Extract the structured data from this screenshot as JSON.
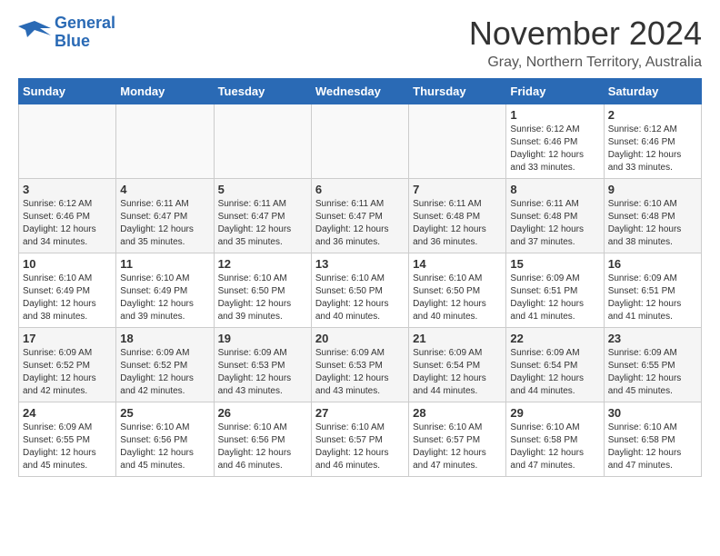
{
  "header": {
    "logo_line1": "General",
    "logo_line2": "Blue",
    "month_title": "November 2024",
    "location": "Gray, Northern Territory, Australia"
  },
  "weekdays": [
    "Sunday",
    "Monday",
    "Tuesday",
    "Wednesday",
    "Thursday",
    "Friday",
    "Saturday"
  ],
  "weeks": [
    [
      {
        "day": "",
        "info": ""
      },
      {
        "day": "",
        "info": ""
      },
      {
        "day": "",
        "info": ""
      },
      {
        "day": "",
        "info": ""
      },
      {
        "day": "",
        "info": ""
      },
      {
        "day": "1",
        "info": "Sunrise: 6:12 AM\nSunset: 6:46 PM\nDaylight: 12 hours\nand 33 minutes."
      },
      {
        "day": "2",
        "info": "Sunrise: 6:12 AM\nSunset: 6:46 PM\nDaylight: 12 hours\nand 33 minutes."
      }
    ],
    [
      {
        "day": "3",
        "info": "Sunrise: 6:12 AM\nSunset: 6:46 PM\nDaylight: 12 hours\nand 34 minutes."
      },
      {
        "day": "4",
        "info": "Sunrise: 6:11 AM\nSunset: 6:47 PM\nDaylight: 12 hours\nand 35 minutes."
      },
      {
        "day": "5",
        "info": "Sunrise: 6:11 AM\nSunset: 6:47 PM\nDaylight: 12 hours\nand 35 minutes."
      },
      {
        "day": "6",
        "info": "Sunrise: 6:11 AM\nSunset: 6:47 PM\nDaylight: 12 hours\nand 36 minutes."
      },
      {
        "day": "7",
        "info": "Sunrise: 6:11 AM\nSunset: 6:48 PM\nDaylight: 12 hours\nand 36 minutes."
      },
      {
        "day": "8",
        "info": "Sunrise: 6:11 AM\nSunset: 6:48 PM\nDaylight: 12 hours\nand 37 minutes."
      },
      {
        "day": "9",
        "info": "Sunrise: 6:10 AM\nSunset: 6:48 PM\nDaylight: 12 hours\nand 38 minutes."
      }
    ],
    [
      {
        "day": "10",
        "info": "Sunrise: 6:10 AM\nSunset: 6:49 PM\nDaylight: 12 hours\nand 38 minutes."
      },
      {
        "day": "11",
        "info": "Sunrise: 6:10 AM\nSunset: 6:49 PM\nDaylight: 12 hours\nand 39 minutes."
      },
      {
        "day": "12",
        "info": "Sunrise: 6:10 AM\nSunset: 6:50 PM\nDaylight: 12 hours\nand 39 minutes."
      },
      {
        "day": "13",
        "info": "Sunrise: 6:10 AM\nSunset: 6:50 PM\nDaylight: 12 hours\nand 40 minutes."
      },
      {
        "day": "14",
        "info": "Sunrise: 6:10 AM\nSunset: 6:50 PM\nDaylight: 12 hours\nand 40 minutes."
      },
      {
        "day": "15",
        "info": "Sunrise: 6:09 AM\nSunset: 6:51 PM\nDaylight: 12 hours\nand 41 minutes."
      },
      {
        "day": "16",
        "info": "Sunrise: 6:09 AM\nSunset: 6:51 PM\nDaylight: 12 hours\nand 41 minutes."
      }
    ],
    [
      {
        "day": "17",
        "info": "Sunrise: 6:09 AM\nSunset: 6:52 PM\nDaylight: 12 hours\nand 42 minutes."
      },
      {
        "day": "18",
        "info": "Sunrise: 6:09 AM\nSunset: 6:52 PM\nDaylight: 12 hours\nand 42 minutes."
      },
      {
        "day": "19",
        "info": "Sunrise: 6:09 AM\nSunset: 6:53 PM\nDaylight: 12 hours\nand 43 minutes."
      },
      {
        "day": "20",
        "info": "Sunrise: 6:09 AM\nSunset: 6:53 PM\nDaylight: 12 hours\nand 43 minutes."
      },
      {
        "day": "21",
        "info": "Sunrise: 6:09 AM\nSunset: 6:54 PM\nDaylight: 12 hours\nand 44 minutes."
      },
      {
        "day": "22",
        "info": "Sunrise: 6:09 AM\nSunset: 6:54 PM\nDaylight: 12 hours\nand 44 minutes."
      },
      {
        "day": "23",
        "info": "Sunrise: 6:09 AM\nSunset: 6:55 PM\nDaylight: 12 hours\nand 45 minutes."
      }
    ],
    [
      {
        "day": "24",
        "info": "Sunrise: 6:09 AM\nSunset: 6:55 PM\nDaylight: 12 hours\nand 45 minutes."
      },
      {
        "day": "25",
        "info": "Sunrise: 6:10 AM\nSunset: 6:56 PM\nDaylight: 12 hours\nand 45 minutes."
      },
      {
        "day": "26",
        "info": "Sunrise: 6:10 AM\nSunset: 6:56 PM\nDaylight: 12 hours\nand 46 minutes."
      },
      {
        "day": "27",
        "info": "Sunrise: 6:10 AM\nSunset: 6:57 PM\nDaylight: 12 hours\nand 46 minutes."
      },
      {
        "day": "28",
        "info": "Sunrise: 6:10 AM\nSunset: 6:57 PM\nDaylight: 12 hours\nand 47 minutes."
      },
      {
        "day": "29",
        "info": "Sunrise: 6:10 AM\nSunset: 6:58 PM\nDaylight: 12 hours\nand 47 minutes."
      },
      {
        "day": "30",
        "info": "Sunrise: 6:10 AM\nSunset: 6:58 PM\nDaylight: 12 hours\nand 47 minutes."
      }
    ]
  ]
}
